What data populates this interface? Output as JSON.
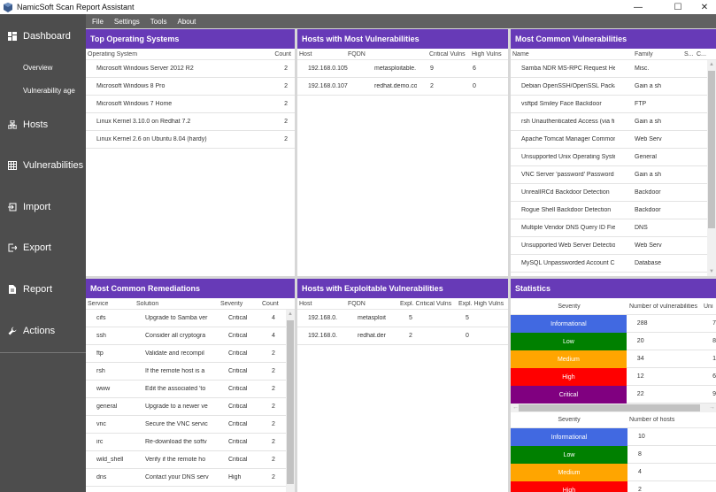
{
  "window": {
    "title": "NamicSoft Scan Report Assistant",
    "controls": {
      "minimize": "—",
      "maximize": "☐",
      "close": "✕"
    }
  },
  "menubar": [
    "File",
    "Settings",
    "Tools",
    "About"
  ],
  "sidebar": {
    "items": [
      {
        "label": "Dashboard",
        "icon": "dashboard-icon"
      },
      {
        "label": "Hosts",
        "icon": "hosts-icon"
      },
      {
        "label": "Vulnerabilities",
        "icon": "grid-icon"
      },
      {
        "label": "Import",
        "icon": "import-icon"
      },
      {
        "label": "Export",
        "icon": "export-icon"
      },
      {
        "label": "Report",
        "icon": "report-icon"
      },
      {
        "label": "Actions",
        "icon": "wrench-icon"
      }
    ],
    "sub_items": [
      "Overview",
      "Vulnerability age"
    ]
  },
  "panels": {
    "top_os": {
      "title": "Top Operating Systems",
      "columns": [
        "Operating System",
        "Count"
      ],
      "rows": [
        [
          "Microsoft Windows Server 2012 R2",
          "2"
        ],
        [
          "Microsoft Windows 8 Pro",
          "2"
        ],
        [
          "Microsoft Windows 7 Home",
          "2"
        ],
        [
          "Linux Kernel 3.10.0 on Redhat 7.2",
          "2"
        ],
        [
          "Linux Kernel 2.6 on Ubuntu 8.04 (hardy)",
          "2"
        ]
      ]
    },
    "hosts_most_vulns": {
      "title": "Hosts with Most Vulnerabilities",
      "columns": [
        "Host",
        "FQDN",
        "Critical Vulns",
        "High Vulns"
      ],
      "rows": [
        [
          "192.168.0.105",
          "metasploitable.",
          "9",
          "6"
        ],
        [
          "192.168.0.107",
          "redhat.demo.co",
          "2",
          "0"
        ]
      ]
    },
    "common_vulns": {
      "title": "Most Common Vulnerabilities",
      "columns": [
        "Name",
        "Family",
        "S...",
        "C..."
      ],
      "rows": [
        [
          "Samba NDR MS-RPC Request Heap-",
          "Misc."
        ],
        [
          "Debian OpenSSH/OpenSSL Package",
          "Gain a sh"
        ],
        [
          "vsftpd Smiley Face Backdoor",
          "FTP"
        ],
        [
          "rsh Unauthenticated Access (via fing",
          "Gain a sh"
        ],
        [
          "Apache Tomcat Manager Common /",
          "Web Serv"
        ],
        [
          "Unsupported Unix Operating System",
          "General"
        ],
        [
          "VNC Server 'password' Password",
          "Gain a sh"
        ],
        [
          "UnrealIRCd Backdoor Detection",
          "Backdoor"
        ],
        [
          "Rogue Shell Backdoor Detection",
          "Backdoor"
        ],
        [
          "Multiple Vendor DNS Query ID Field I",
          "DNS"
        ],
        [
          "Unsupported Web Server Detection",
          "Web Serv"
        ],
        [
          "MySQL Unpassworded Account Che",
          "Database"
        ]
      ]
    },
    "remediations": {
      "title": "Most Common Remediations",
      "columns": [
        "Service",
        "Solution",
        "Severity",
        "Count"
      ],
      "rows": [
        [
          "cifs",
          "Upgrade to Samba ver",
          "Critical",
          "4"
        ],
        [
          "ssh",
          "Consider all cryptogra",
          "Critical",
          "4"
        ],
        [
          "ftp",
          "Validate and recompil",
          "Critical",
          "2"
        ],
        [
          "rsh",
          "If the remote host is a",
          "Critical",
          "2"
        ],
        [
          "www",
          "Edit the associated 'to",
          "Critical",
          "2"
        ],
        [
          "general",
          "Upgrade to a newer ve",
          "Critical",
          "2"
        ],
        [
          "vnc",
          "Secure the VNC servic",
          "Critical",
          "2"
        ],
        [
          "irc",
          "Re-download the softv",
          "Critical",
          "2"
        ],
        [
          "wild_shell",
          "Verify if the remote ho",
          "Critical",
          "2"
        ],
        [
          "dns",
          "Contact your DNS serv",
          "High",
          "2"
        ]
      ]
    },
    "exploitable": {
      "title": "Hosts with Exploitable Vulnerabilities",
      "columns": [
        "Host",
        "FQDN",
        "Expl. Critical Vulns",
        "Expl. High Vulns"
      ],
      "rows": [
        [
          "192.168.0.",
          "metasploit",
          "5",
          "5"
        ],
        [
          "192.168.0.",
          "redhat.der",
          "2",
          "0"
        ]
      ]
    },
    "statistics": {
      "title": "Statistics",
      "vuln_table": {
        "columns": [
          "Severity",
          "Number of vulnerabilities",
          "Uni"
        ],
        "rows": [
          {
            "severity": "Informational",
            "count": "288",
            "unique": "7",
            "color": "#4169e1"
          },
          {
            "severity": "Low",
            "count": "20",
            "unique": "8",
            "color": "#008000"
          },
          {
            "severity": "Medium",
            "count": "34",
            "unique": "1",
            "color": "#ffa500"
          },
          {
            "severity": "High",
            "count": "12",
            "unique": "6",
            "color": "#ff0000"
          },
          {
            "severity": "Critical",
            "count": "22",
            "unique": "9",
            "color": "#800080"
          }
        ]
      },
      "host_table": {
        "columns": [
          "Severity",
          "Number of hosts"
        ],
        "rows": [
          {
            "severity": "Informational",
            "count": "10",
            "color": "#4169e1"
          },
          {
            "severity": "Low",
            "count": "8",
            "color": "#008000"
          },
          {
            "severity": "Medium",
            "count": "4",
            "color": "#ffa500"
          },
          {
            "severity": "High",
            "count": "2",
            "color": "#ff0000"
          }
        ]
      }
    }
  },
  "colors": {
    "header": "#673ab7",
    "sidebar": "#4d4d4d",
    "menubar": "#616161"
  }
}
